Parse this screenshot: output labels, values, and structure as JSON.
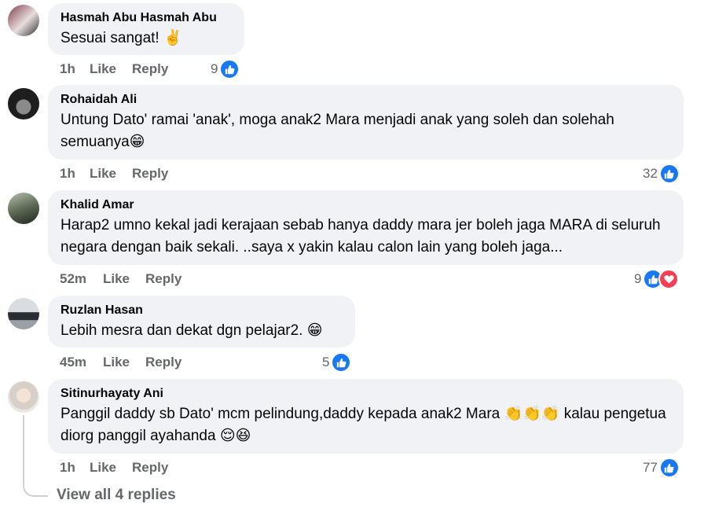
{
  "comments": [
    {
      "author": "Hasmah Abu Hasmah Abu",
      "text": "Sesuai sangat! ✌️",
      "time": "1h",
      "like": "Like",
      "reply": "Reply",
      "reaction_count": "9",
      "reactions": [
        "like"
      ]
    },
    {
      "author": "Rohaidah Ali",
      "text": "Untung Dato' ramai 'anak', moga anak2 Mara menjadi anak yang soleh dan solehah semuanya😁",
      "time": "1h",
      "like": "Like",
      "reply": "Reply",
      "reaction_count": "32",
      "reactions": [
        "like"
      ]
    },
    {
      "author": "Khalid Amar",
      "text": "Harap2 umno kekal jadi kerajaan sebab hanya daddy mara jer boleh jaga MARA di seluruh negara dengan baik sekali. ..saya x yakin kalau calon lain yang boleh jaga...",
      "time": "52m",
      "like": "Like",
      "reply": "Reply",
      "reaction_count": "9",
      "reactions": [
        "like",
        "love"
      ]
    },
    {
      "author": "Ruzlan Hasan",
      "text": "Lebih mesra dan dekat dgn pelajar2. 😁",
      "time": "45m",
      "like": "Like",
      "reply": "Reply",
      "reaction_count": "5",
      "reactions": [
        "like"
      ]
    },
    {
      "author": "Sitinurhayaty Ani",
      "text": "Panggil daddy sb Dato' mcm pelindung,daddy kepada anak2 Mara 👏👏👏 kalau pengetua diorg panggil ayahanda 😌😆",
      "time": "1h",
      "like": "Like",
      "reply": "Reply",
      "reaction_count": "77",
      "reactions": [
        "like"
      ]
    }
  ],
  "view_replies": "View all 4 replies",
  "colors": {
    "bubble": "#f0f2f5",
    "like_blue": "#1877f2",
    "love_red": "#f33e58",
    "meta_gray": "#65676b"
  }
}
